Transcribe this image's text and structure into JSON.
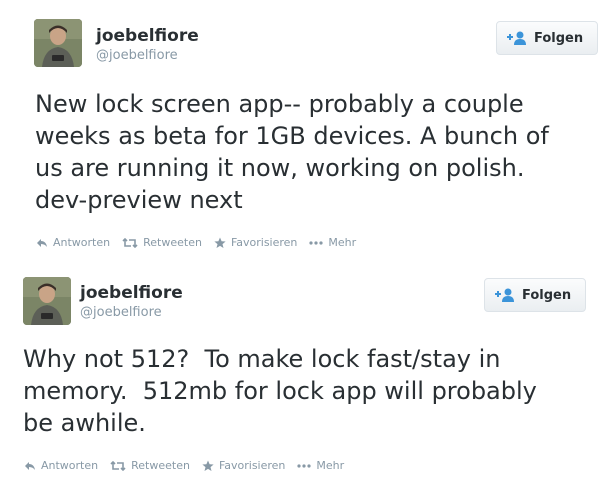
{
  "tweets": [
    {
      "name": "joebelfiore",
      "handle": "@joebelfiore",
      "follow_label": "Folgen",
      "text": "New lock screen app-- probably a couple\nweeks as beta for 1GB devices. A bunch of\nus are running it now, working on polish.\ndev-preview next",
      "actions": {
        "reply": "Antworten",
        "retweet": "Retweeten",
        "favorite": "Favorisieren",
        "more": "Mehr"
      }
    },
    {
      "name": "joebelfiore",
      "handle": "@joebelfiore",
      "follow_label": "Folgen",
      "text": "Why not 512?  To make lock fast/stay in\nmemory.  512mb for lock app will probably\nbe awhile.",
      "actions": {
        "reply": "Antworten",
        "retweet": "Retweeten",
        "favorite": "Favorisieren",
        "more": "Mehr"
      }
    }
  ],
  "colors": {
    "text": "#292f33",
    "muted": "#8899a6",
    "follow_icon": "#3b94d9"
  },
  "icons": [
    "avatar",
    "add-user-icon",
    "reply-icon",
    "retweet-icon",
    "favorite-icon",
    "more-icon"
  ]
}
